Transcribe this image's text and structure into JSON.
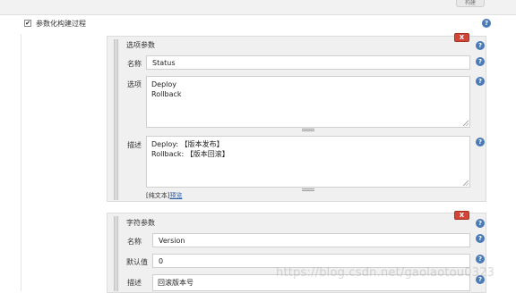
{
  "top_button": "构建",
  "section": {
    "checked": true,
    "title": "参数化构建过程"
  },
  "help_glyph": "?",
  "choice_param": {
    "title": "选项参数",
    "delete_label": "X",
    "name_label": "名称",
    "name_value": "Status",
    "choices_label": "选项",
    "choices_value": "Deploy\nRollback",
    "desc_label": "描述",
    "desc_value": "Deploy: 【版本发布】\nRollback: 【版本回滚】",
    "text_mode": "[纯文本]",
    "preview": "预览"
  },
  "string_param": {
    "title": "字符参数",
    "delete_label": "X",
    "name_label": "名称",
    "name_value": "Version",
    "default_label": "默认值",
    "default_value": "0",
    "desc_label": "描述",
    "desc_value": "回滚版本号"
  },
  "watermark": "https://blog.csdn.net/gaolaotou0323",
  "colors": {
    "accent": "#4a7ab8",
    "delete": "#d24638",
    "card_bg": "#f0f0f0"
  }
}
